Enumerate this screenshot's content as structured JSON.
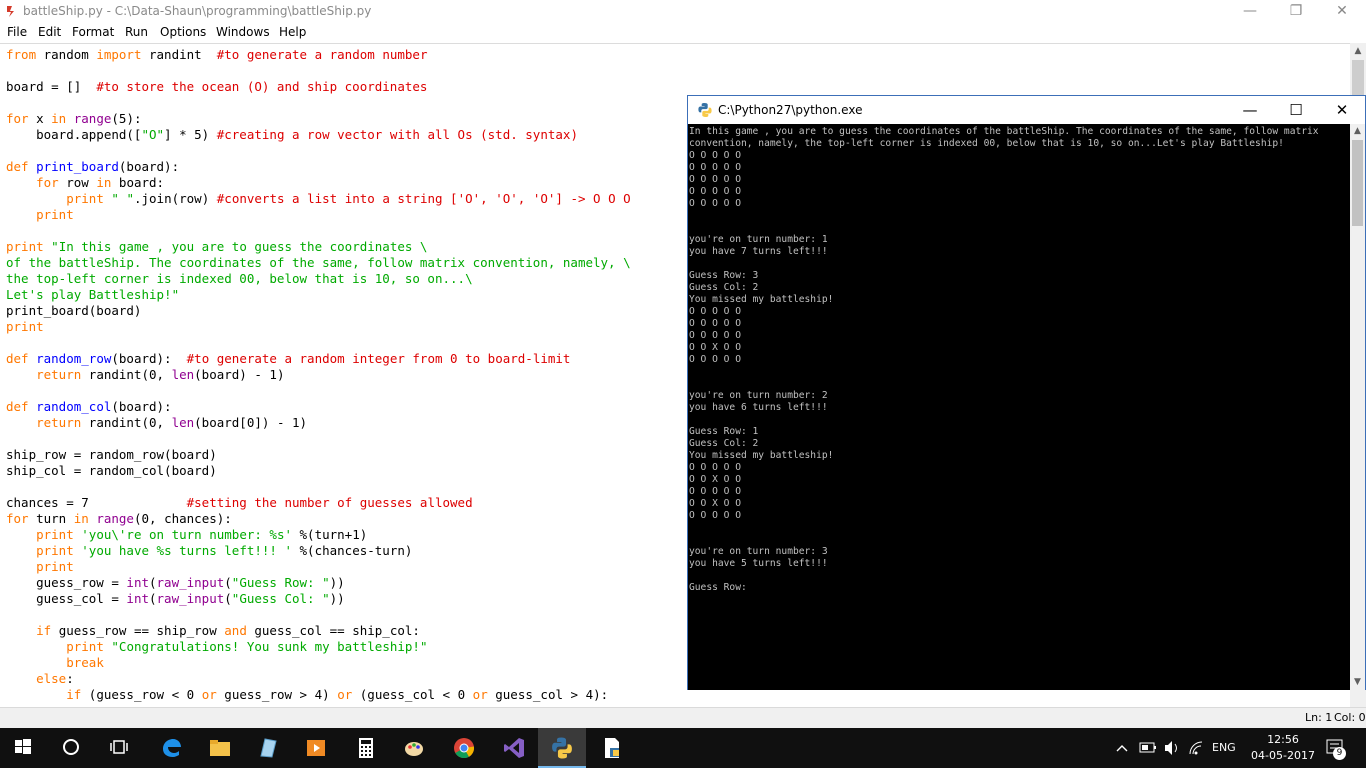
{
  "idle_window": {
    "title": "battleShip.py - C:\\Data-Shaun\\programming\\battleShip.py",
    "menu": [
      "File",
      "Edit",
      "Format",
      "Run",
      "Options",
      "Windows",
      "Help"
    ],
    "status": {
      "line": "Ln: 1",
      "col": "Col: 0"
    }
  },
  "code_lines": [
    [
      [
        "kw",
        "from"
      ],
      [
        "n",
        " random "
      ],
      [
        "kw",
        "import"
      ],
      [
        "n",
        " randint  "
      ],
      [
        "cm",
        "#to generate a random number"
      ]
    ],
    [],
    [
      [
        "n",
        "board = []  "
      ],
      [
        "cm",
        "#to store the ocean (O) and ship coordinates"
      ]
    ],
    [],
    [
      [
        "kw",
        "for"
      ],
      [
        "n",
        " x "
      ],
      [
        "kw",
        "in"
      ],
      [
        "n",
        " "
      ],
      [
        "bi",
        "range"
      ],
      [
        "n",
        "(5):"
      ]
    ],
    [
      [
        "n",
        "    board.append(["
      ],
      [
        "st",
        "\"O\""
      ],
      [
        "n",
        "] * 5) "
      ],
      [
        "cm",
        "#creating a row vector with all Os (std. syntax)"
      ]
    ],
    [],
    [
      [
        "kw",
        "def"
      ],
      [
        "n",
        " "
      ],
      [
        "df",
        "print_board"
      ],
      [
        "n",
        "(board):"
      ]
    ],
    [
      [
        "n",
        "    "
      ],
      [
        "kw",
        "for"
      ],
      [
        "n",
        " row "
      ],
      [
        "kw",
        "in"
      ],
      [
        "n",
        " board:"
      ]
    ],
    [
      [
        "n",
        "        "
      ],
      [
        "kw",
        "print"
      ],
      [
        "n",
        " "
      ],
      [
        "st",
        "\" \""
      ],
      [
        "n",
        ".join(row) "
      ],
      [
        "cm",
        "#converts a list into a string ['O', 'O', 'O'] -> O O O"
      ]
    ],
    [
      [
        "n",
        "    "
      ],
      [
        "kw",
        "print"
      ]
    ],
    [],
    [
      [
        "kw",
        "print"
      ],
      [
        "n",
        " "
      ],
      [
        "st",
        "\"In this game , you are to guess the coordinates \\"
      ]
    ],
    [
      [
        "st",
        "of the battleShip. The coordinates of the same, follow matrix convention, namely, \\"
      ]
    ],
    [
      [
        "st",
        "the top-left corner is indexed 00, below that is 10, so on...\\"
      ]
    ],
    [
      [
        "st",
        "Let's play Battleship!\""
      ]
    ],
    [
      [
        "n",
        "print_board(board)"
      ]
    ],
    [
      [
        "kw",
        "print"
      ]
    ],
    [],
    [
      [
        "kw",
        "def"
      ],
      [
        "n",
        " "
      ],
      [
        "df",
        "random_row"
      ],
      [
        "n",
        "(board):  "
      ],
      [
        "cm",
        "#to generate a random integer from 0 to board-limit"
      ]
    ],
    [
      [
        "n",
        "    "
      ],
      [
        "kw",
        "return"
      ],
      [
        "n",
        " randint(0, "
      ],
      [
        "bi",
        "len"
      ],
      [
        "n",
        "(board) - 1)"
      ]
    ],
    [],
    [
      [
        "kw",
        "def"
      ],
      [
        "n",
        " "
      ],
      [
        "df",
        "random_col"
      ],
      [
        "n",
        "(board):"
      ]
    ],
    [
      [
        "n",
        "    "
      ],
      [
        "kw",
        "return"
      ],
      [
        "n",
        " randint(0, "
      ],
      [
        "bi",
        "len"
      ],
      [
        "n",
        "(board[0]) - 1)"
      ]
    ],
    [],
    [
      [
        "n",
        "ship_row = random_row(board)"
      ]
    ],
    [
      [
        "n",
        "ship_col = random_col(board)"
      ]
    ],
    [],
    [
      [
        "n",
        "chances = 7             "
      ],
      [
        "cm",
        "#setting the number of guesses allowed"
      ]
    ],
    [
      [
        "kw",
        "for"
      ],
      [
        "n",
        " turn "
      ],
      [
        "kw",
        "in"
      ],
      [
        "n",
        " "
      ],
      [
        "bi",
        "range"
      ],
      [
        "n",
        "(0, chances):"
      ]
    ],
    [
      [
        "n",
        "    "
      ],
      [
        "kw",
        "print"
      ],
      [
        "n",
        " "
      ],
      [
        "st",
        "'you\\'re on turn number: %s'"
      ],
      [
        "n",
        " %(turn+1)"
      ]
    ],
    [
      [
        "n",
        "    "
      ],
      [
        "kw",
        "print"
      ],
      [
        "n",
        " "
      ],
      [
        "st",
        "'you have %s turns left!!! '"
      ],
      [
        "n",
        " %(chances-turn)"
      ]
    ],
    [
      [
        "n",
        "    "
      ],
      [
        "kw",
        "print"
      ]
    ],
    [
      [
        "n",
        "    guess_row = "
      ],
      [
        "bi",
        "int"
      ],
      [
        "n",
        "("
      ],
      [
        "bi",
        "raw_input"
      ],
      [
        "n",
        "("
      ],
      [
        "st",
        "\"Guess Row: \""
      ],
      [
        "n",
        "))"
      ]
    ],
    [
      [
        "n",
        "    guess_col = "
      ],
      [
        "bi",
        "int"
      ],
      [
        "n",
        "("
      ],
      [
        "bi",
        "raw_input"
      ],
      [
        "n",
        "("
      ],
      [
        "st",
        "\"Guess Col: \""
      ],
      [
        "n",
        "))"
      ]
    ],
    [],
    [
      [
        "n",
        "    "
      ],
      [
        "kw",
        "if"
      ],
      [
        "n",
        " guess_row == ship_row "
      ],
      [
        "kw",
        "and"
      ],
      [
        "n",
        " guess_col == ship_col:"
      ]
    ],
    [
      [
        "n",
        "        "
      ],
      [
        "kw",
        "print"
      ],
      [
        "n",
        " "
      ],
      [
        "st",
        "\"Congratulations! You sunk my battleship!\""
      ]
    ],
    [
      [
        "n",
        "        "
      ],
      [
        "kw",
        "break"
      ]
    ],
    [
      [
        "n",
        "    "
      ],
      [
        "kw",
        "else"
      ],
      [
        "n",
        ":"
      ]
    ],
    [
      [
        "n",
        "        "
      ],
      [
        "kw",
        "if"
      ],
      [
        "n",
        " (guess_row < 0 "
      ],
      [
        "kw",
        "or"
      ],
      [
        "n",
        " guess_row > 4) "
      ],
      [
        "kw",
        "or"
      ],
      [
        "n",
        " (guess_col < 0 "
      ],
      [
        "kw",
        "or"
      ],
      [
        "n",
        " guess_col > 4):"
      ]
    ]
  ],
  "console_window": {
    "title": "C:\\Python27\\python.exe",
    "lines": [
      "In this game , you are to guess the coordinates of the battleShip. The coordinates of the same, follow matrix",
      "convention, namely, the top-left corner is indexed 00, below that is 10, so on...Let's play Battleship!",
      "O O O O O",
      "O O O O O",
      "O O O O O",
      "O O O O O",
      "O O O O O",
      "",
      "",
      "you're on turn number: 1",
      "you have 7 turns left!!!",
      "",
      "Guess Row: 3",
      "Guess Col: 2",
      "You missed my battleship!",
      "O O O O O",
      "O O O O O",
      "O O O O O",
      "O O X O O",
      "O O O O O",
      "",
      "",
      "you're on turn number: 2",
      "you have 6 turns left!!!",
      "",
      "Guess Row: 1",
      "Guess Col: 2",
      "You missed my battleship!",
      "O O O O O",
      "O O X O O",
      "O O O O O",
      "O O X O O",
      "O O O O O",
      "",
      "",
      "you're on turn number: 3",
      "you have 5 turns left!!!",
      "",
      "Guess Row:"
    ]
  },
  "taskbar": {
    "apps": [
      "start-icon",
      "cortana-icon",
      "task-view-icon",
      "edge-icon",
      "file-explorer-icon",
      "notepad-icon",
      "media-player-icon",
      "calculator-icon",
      "paint-icon",
      "chrome-icon",
      "visual-studio-icon",
      "python-icon",
      "idle-icon"
    ],
    "language": "ENG",
    "time": "12:56",
    "date": "04-05-2017",
    "notification_count": "9"
  }
}
